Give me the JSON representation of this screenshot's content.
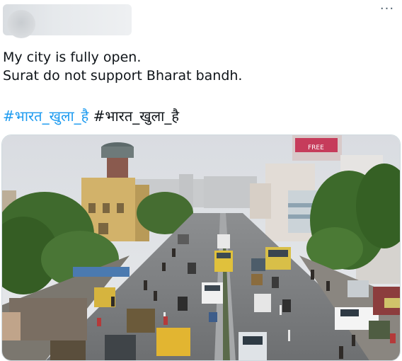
{
  "header": {
    "more_label": "···"
  },
  "tweet": {
    "line1": "My city is fully open.",
    "line2": "Surat do not support Bharat bandh.",
    "hashtag_link": "#भारत_खुला_है",
    "hashtag_plain": "#भारत_खुला_है"
  },
  "media": {
    "subject": "busy-street-photo",
    "shop_sign_text": "FREE"
  },
  "colors": {
    "link": "#1d9bf0",
    "text": "#0f1419",
    "border": "#cfd9de"
  }
}
